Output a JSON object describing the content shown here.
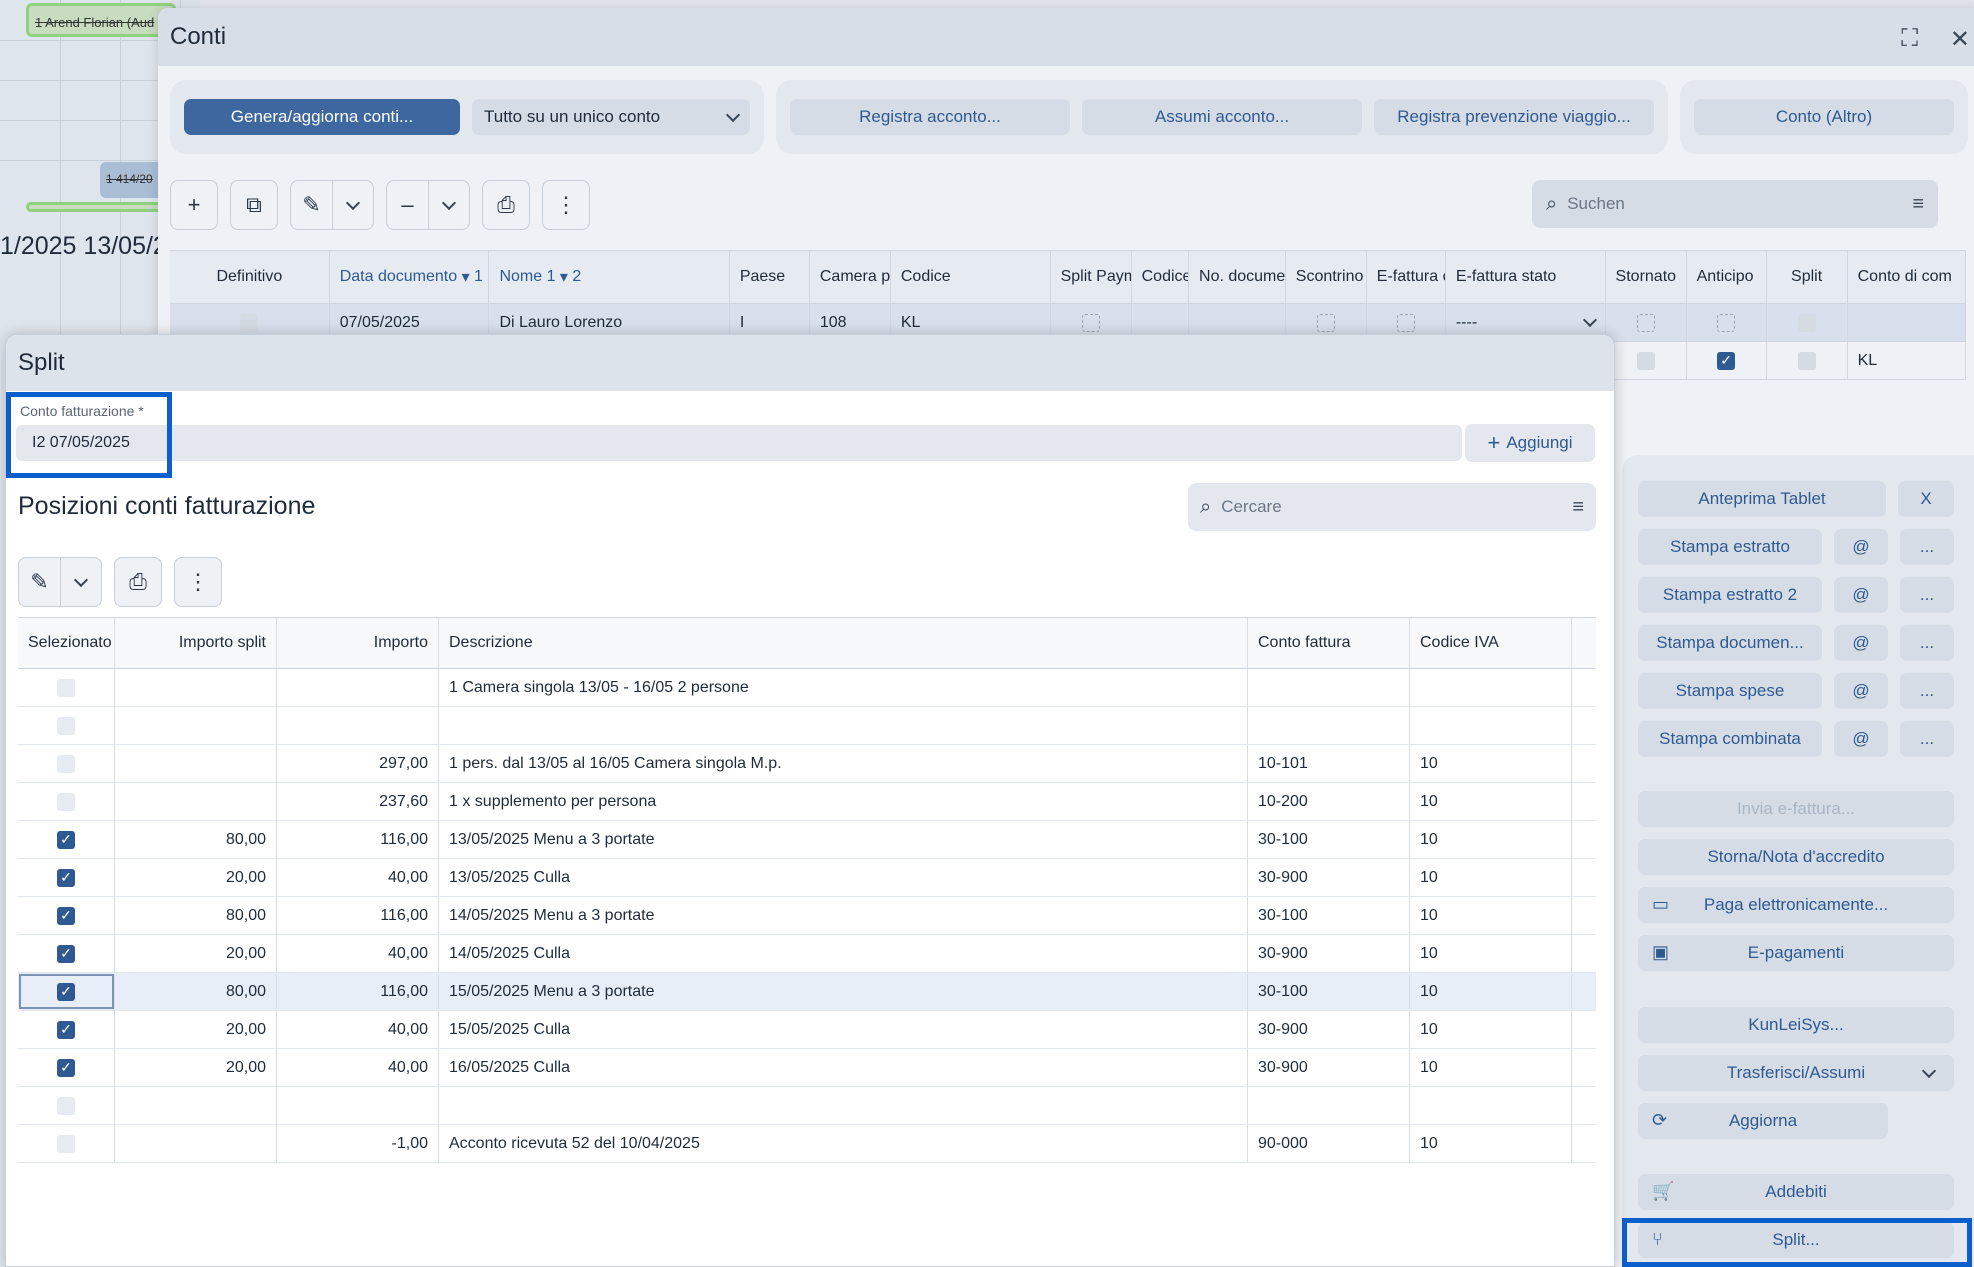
{
  "background": {
    "booking1": "1 Arend Florian (Aud",
    "booking2": "1 414/20",
    "datestrip": "1/2025 13/05/2"
  },
  "conti": {
    "title": "Conti",
    "toolbar": {
      "generate": "Genera/aggiorna conti...",
      "mode_select": "Tutto su un unico conto",
      "registra_acconto": "Registra acconto...",
      "assumi_acconto": "Assumi acconto...",
      "registra_prevenzione": "Registra prevenzione viaggio...",
      "conto_altro": "Conto (Altro)"
    },
    "search_placeholder": "Suchen",
    "columns": [
      {
        "label": "Definitivo"
      },
      {
        "label": "Data documento",
        "sort": "1"
      },
      {
        "label": "Nome 1",
        "sort": "2"
      },
      {
        "label": "Paese"
      },
      {
        "label": "Camera p"
      },
      {
        "label": "Codice"
      },
      {
        "label": "Split Paym"
      },
      {
        "label": "Codice r"
      },
      {
        "label": "No. docume"
      },
      {
        "label": "Scontrino"
      },
      {
        "label": "E-fattura c"
      },
      {
        "label": "E-fattura stato"
      },
      {
        "label": "Stornato"
      },
      {
        "label": "Anticipo"
      },
      {
        "label": "Split"
      },
      {
        "label": "Conto di com"
      }
    ],
    "rows": [
      {
        "data": "07/05/2025",
        "nome": "Di Lauro Lorenzo",
        "paese": "I",
        "camera": "108",
        "codice": "KL",
        "efattura_stato": "----"
      },
      {
        "conto_di_com": "KL"
      }
    ]
  },
  "actions": {
    "anteprima_tablet": "Anteprima Tablet",
    "x": "X",
    "stampa_estratto": "Stampa estratto",
    "stampa_estratto_2": "Stampa estratto 2",
    "stampa_documento": "Stampa documen...",
    "stampa_spese": "Stampa spese",
    "stampa_combinata": "Stampa combinata",
    "at": "@",
    "dots": "...",
    "invia_efattura": "Invia e-fattura...",
    "storna": "Storna/Nota d'accredito",
    "paga": "Paga elettronicamente...",
    "epagamenti": "E-pagamenti",
    "kunleisys": "KunLeiSys...",
    "trasferisci": "Trasferisci/Assumi",
    "aggiorna": "Aggiorna",
    "addebiti": "Addebiti",
    "split": "Split..."
  },
  "split": {
    "title": "Split",
    "field_label": "Conto fatturazione *",
    "field_value": "I2  07/05/2025",
    "add_label": "Aggiungi",
    "section_title": "Posizioni conti fatturazione",
    "search_placeholder": "Cercare",
    "columns": {
      "selezionato": "Selezionato",
      "importo_split": "Importo split",
      "importo": "Importo",
      "descrizione": "Descrizione",
      "conto_fattura": "Conto fattura",
      "codice_iva": "Codice IVA"
    },
    "rows": [
      {
        "checked": false,
        "importo_split": "",
        "importo": "",
        "descrizione": "1 Camera singola  13/05 - 16/05  2 persone",
        "conto": "",
        "iva": ""
      },
      {
        "checked": false,
        "importo_split": "",
        "importo": "",
        "descrizione": "",
        "conto": "",
        "iva": ""
      },
      {
        "checked": false,
        "importo_split": "",
        "importo": "297,00",
        "descrizione": "1 pers. dal 13/05 al 16/05 Camera singola M.p.",
        "conto": "10-101",
        "iva": "10"
      },
      {
        "checked": false,
        "importo_split": "",
        "importo": "237,60",
        "descrizione": "1 x supplemento per persona",
        "conto": "10-200",
        "iva": "10"
      },
      {
        "checked": true,
        "importo_split": "80,00",
        "importo": "116,00",
        "descrizione": "13/05/2025 Menu a 3 portate",
        "conto": "30-100",
        "iva": "10"
      },
      {
        "checked": true,
        "importo_split": "20,00",
        "importo": "40,00",
        "descrizione": "13/05/2025 Culla",
        "conto": "30-900",
        "iva": "10"
      },
      {
        "checked": true,
        "importo_split": "80,00",
        "importo": "116,00",
        "descrizione": "14/05/2025 Menu a 3 portate",
        "conto": "30-100",
        "iva": "10"
      },
      {
        "checked": true,
        "importo_split": "20,00",
        "importo": "40,00",
        "descrizione": "14/05/2025 Culla",
        "conto": "30-900",
        "iva": "10"
      },
      {
        "checked": true,
        "importo_split": "80,00",
        "importo": "116,00",
        "descrizione": "15/05/2025 Menu a 3 portate",
        "conto": "30-100",
        "iva": "10",
        "selected": true
      },
      {
        "checked": true,
        "importo_split": "20,00",
        "importo": "40,00",
        "descrizione": "15/05/2025 Culla",
        "conto": "30-900",
        "iva": "10"
      },
      {
        "checked": true,
        "importo_split": "20,00",
        "importo": "40,00",
        "descrizione": "16/05/2025 Culla",
        "conto": "30-900",
        "iva": "10"
      },
      {
        "checked": false,
        "importo_split": "",
        "importo": "",
        "descrizione": "",
        "conto": "",
        "iva": ""
      },
      {
        "checked": false,
        "importo_split": "",
        "importo": "-1,00",
        "descrizione": "Acconto ricevuta 52 del 10/04/2025",
        "conto": "90-000",
        "iva": "10"
      }
    ]
  }
}
